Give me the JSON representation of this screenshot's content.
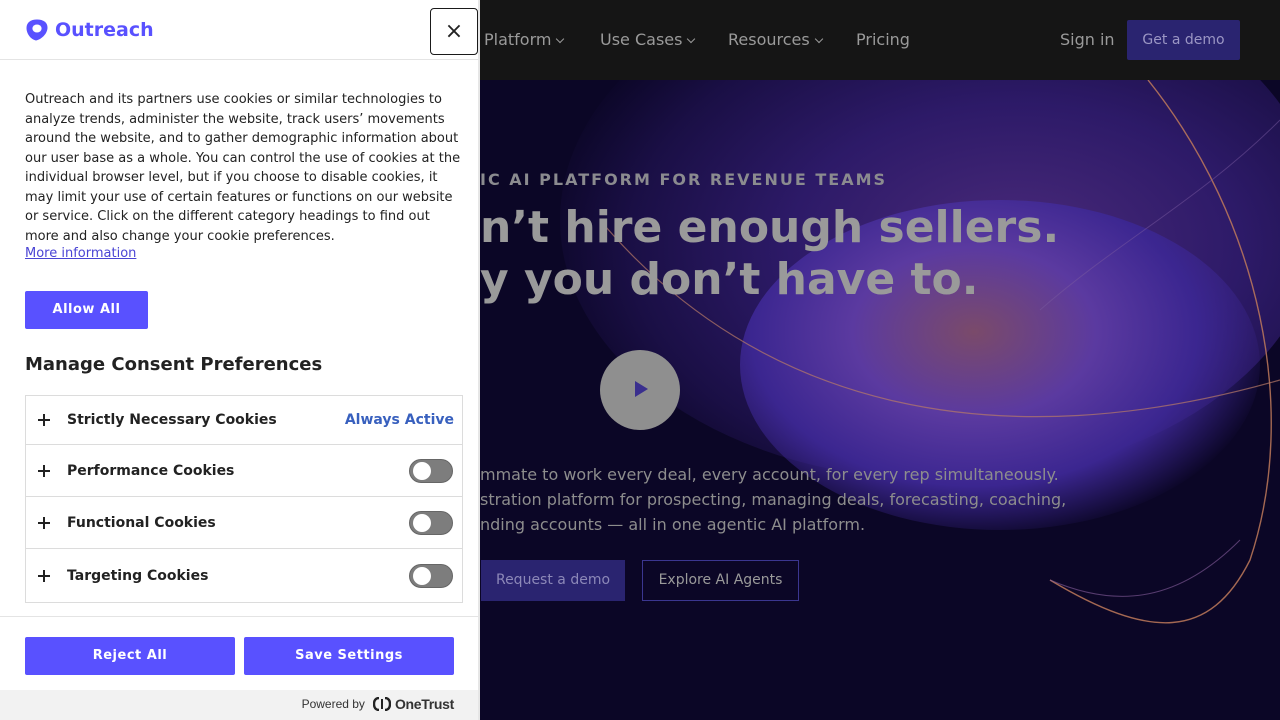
{
  "site": {
    "nav": {
      "items": [
        "Platform",
        "Use Cases",
        "Resources",
        "Pricing"
      ],
      "sign_in": "Sign in",
      "get_demo": "Get a demo"
    },
    "hero": {
      "eyebrow": "IC AI PLATFORM FOR REVENUE TEAMS",
      "headline_line1": "n’t hire enough sellers.",
      "headline_line2": "y you don’t have to.",
      "subcopy_line1": "mmate to work every deal, every account, for every rep simultaneously.",
      "subcopy_line2": "stration platform for prospecting, managing deals, forecasting, coaching,",
      "subcopy_line3": "nding accounts — all in one agentic AI platform.",
      "request_demo": "Request a demo",
      "explore_agents": "Explore AI Agents"
    }
  },
  "cookie_panel": {
    "logo_text": "Outreach",
    "close_glyph": "×",
    "policy_text": "Outreach and its partners use cookies or similar technologies to analyze trends, administer the website, track users’ movements around the website, and to gather demographic information about our user base as a whole. You can control the use of cookies at the individual browser level, but if you choose to disable cookies, it may limit your use of certain features or functions on our website or service. Click on the different category headings to find out more and also change your cookie preferences.",
    "more_info": "More information",
    "allow_all": "Allow All",
    "manage_title": "Manage Consent Preferences",
    "categories": [
      {
        "label": "Strictly Necessary Cookies",
        "status": "Always Active"
      },
      {
        "label": "Performance Cookies",
        "enabled": false
      },
      {
        "label": "Functional Cookies",
        "enabled": false
      },
      {
        "label": "Targeting Cookies",
        "enabled": false
      }
    ],
    "reject_all": "Reject All",
    "save_settings": "Save Settings",
    "powered_by": "Powered by",
    "onetrust": "OneTrust"
  },
  "colors": {
    "accent": "#5951ff",
    "link": "#4a44d4",
    "always_active": "#3860be",
    "toggle_off": "#7d7d7d",
    "nav_bg": "#151515",
    "hero_bg": "#0b0626"
  },
  "icons": [
    "outreach-logo-icon",
    "close-icon",
    "chevron-down-icon",
    "play-icon",
    "plus-icon",
    "onetrust-logo-icon"
  ]
}
